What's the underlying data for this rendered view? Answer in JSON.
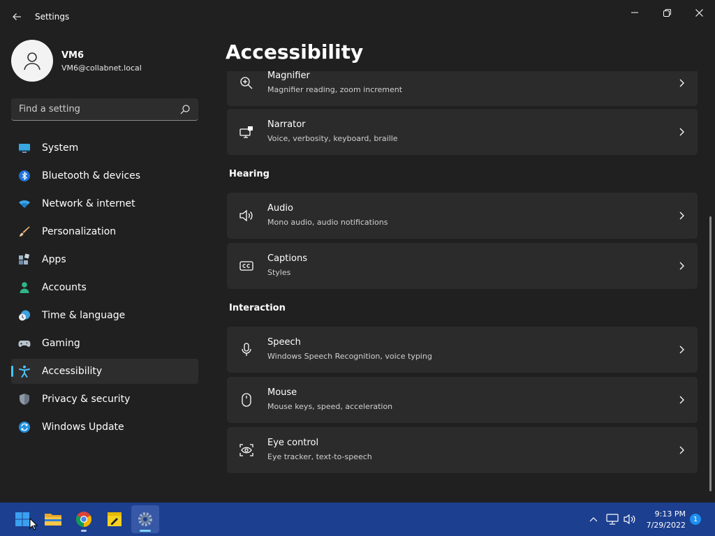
{
  "window": {
    "title": "Settings"
  },
  "profile": {
    "name": "VM6",
    "email": "VM6@collabnet.local"
  },
  "search": {
    "placeholder": "Find a setting"
  },
  "sidebar": {
    "items": [
      {
        "label": "System",
        "icon": "monitor-icon"
      },
      {
        "label": "Bluetooth & devices",
        "icon": "bluetooth-icon"
      },
      {
        "label": "Network & internet",
        "icon": "wifi-icon"
      },
      {
        "label": "Personalization",
        "icon": "brush-icon"
      },
      {
        "label": "Apps",
        "icon": "apps-icon"
      },
      {
        "label": "Accounts",
        "icon": "person-icon"
      },
      {
        "label": "Time & language",
        "icon": "clock-globe-icon"
      },
      {
        "label": "Gaming",
        "icon": "gamepad-icon"
      },
      {
        "label": "Accessibility",
        "icon": "accessibility-icon",
        "active": true
      },
      {
        "label": "Privacy & security",
        "icon": "shield-icon"
      },
      {
        "label": "Windows Update",
        "icon": "update-icon"
      }
    ]
  },
  "main": {
    "title": "Accessibility",
    "cards_top": [
      {
        "title": "Magnifier",
        "subtitle": "Magnifier reading, zoom increment",
        "icon": "magnifier-icon"
      },
      {
        "title": "Narrator",
        "subtitle": "Voice, verbosity, keyboard, braille",
        "icon": "narrator-icon"
      }
    ],
    "hearing": {
      "heading": "Hearing",
      "cards": [
        {
          "title": "Audio",
          "subtitle": "Mono audio, audio notifications",
          "icon": "speaker-icon"
        },
        {
          "title": "Captions",
          "subtitle": "Styles",
          "icon": "captions-icon"
        }
      ]
    },
    "interaction": {
      "heading": "Interaction",
      "cards": [
        {
          "title": "Speech",
          "subtitle": "Windows Speech Recognition, voice typing",
          "icon": "microphone-icon"
        },
        {
          "title": "Mouse",
          "subtitle": "Mouse keys, speed, acceleration",
          "icon": "mouse-icon"
        },
        {
          "title": "Eye control",
          "subtitle": "Eye tracker, text-to-speech",
          "icon": "eye-control-icon"
        }
      ]
    }
  },
  "taskbar": {
    "apps": [
      "start-icon",
      "file-explorer-icon",
      "chrome-icon",
      "sticky-notes-icon",
      "settings-icon"
    ],
    "clock": {
      "time": "9:13 PM",
      "date": "7/29/2022"
    },
    "notifications": "1"
  },
  "colors": {
    "accent": "#4cc2ff",
    "taskbar": "#1c3f8f",
    "background": "#202020",
    "card": "#2b2b2b"
  }
}
